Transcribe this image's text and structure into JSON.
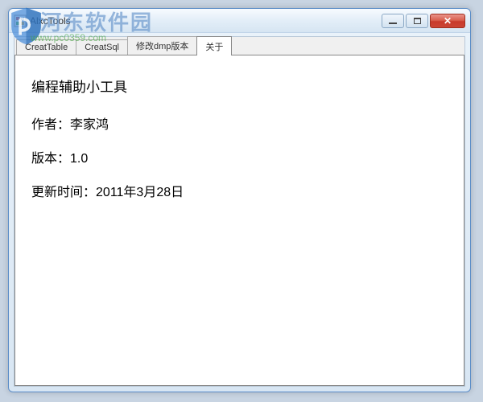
{
  "window": {
    "title": "AlxcTools"
  },
  "tabs": {
    "items": [
      {
        "label": "CreatTable"
      },
      {
        "label": "CreatSql"
      },
      {
        "label": "修改dmp版本"
      },
      {
        "label": "关于"
      }
    ],
    "active_index": 3
  },
  "about": {
    "title": "编程辅助小工具",
    "author_label": "作者：",
    "author_value": "李家鸿",
    "version_label": "版本：",
    "version_value": "1.0",
    "updated_label": "更新时间：",
    "updated_value": "2011年3月28日"
  },
  "watermark": {
    "site_name": "河东软件园",
    "url": "www.pc0359.com"
  }
}
